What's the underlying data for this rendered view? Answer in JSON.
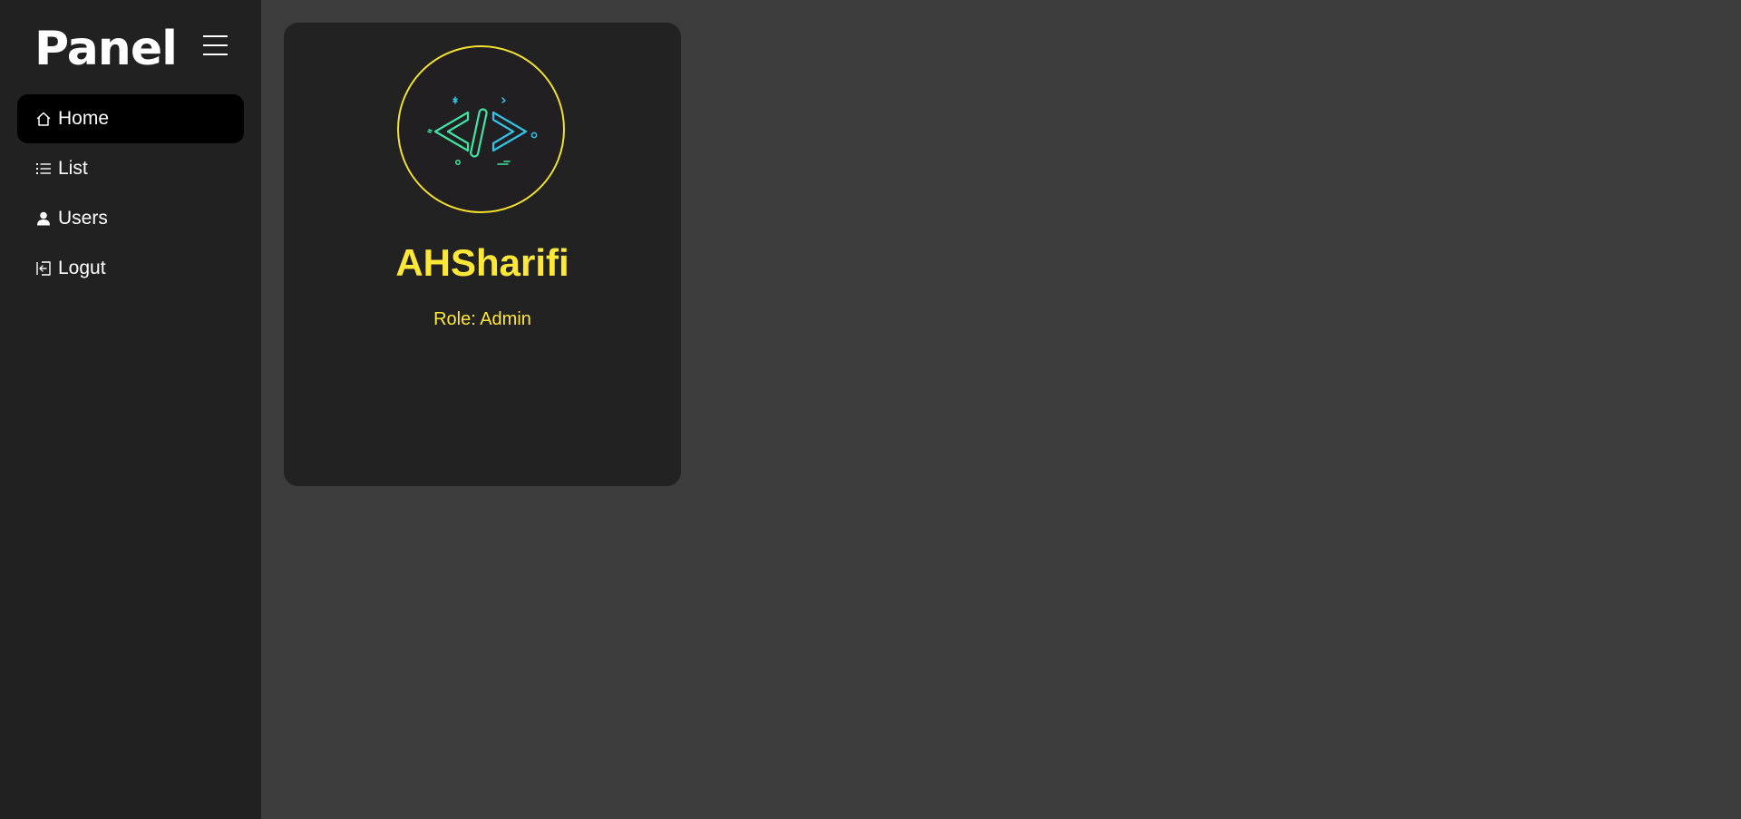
{
  "brand": {
    "title": "Panel"
  },
  "sidebar": {
    "menu_toggle_icon": "hamburger-icon",
    "items": [
      {
        "label": "Home",
        "icon": "home-icon",
        "active": true
      },
      {
        "label": "List",
        "icon": "list-icon",
        "active": false
      },
      {
        "label": "Users",
        "icon": "user-icon",
        "active": false
      },
      {
        "label": "Logut",
        "icon": "logout-icon",
        "active": false
      }
    ]
  },
  "profile": {
    "avatar_icon": "code-brackets-icon",
    "name": "AHSharifi",
    "role": "Role: Admin"
  },
  "colors": {
    "sidebar_bg": "#212121",
    "main_bg": "#3c3c3c",
    "card_bg": "#222222",
    "accent_yellow": "#fde83a",
    "active_item_bg": "#000000",
    "code_green": "#3fe6a3",
    "code_cyan": "#2ec5e8"
  }
}
